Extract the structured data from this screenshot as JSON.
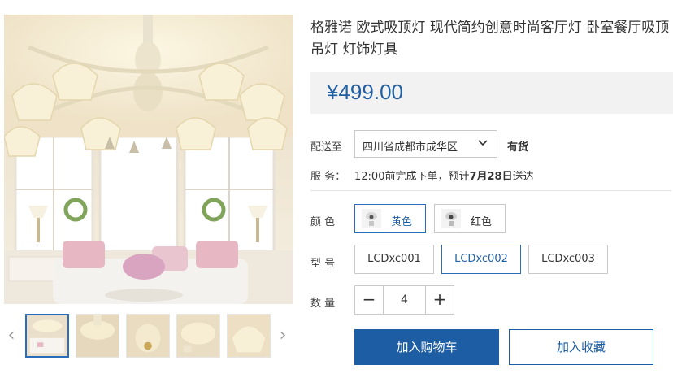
{
  "product": {
    "title": "格雅诺 欧式吸顶灯 现代简约创意时尚客厅灯 卧室餐厅吸顶吊灯 灯饰灯具",
    "price": "¥499.00"
  },
  "gallery": {
    "main_image": "chandelier-living-room-photo",
    "prev_icon": "chevron-left-icon",
    "next_icon": "chevron-right-icon",
    "thumbnails": [
      {
        "image": "chandelier-thumb-1",
        "active": true
      },
      {
        "image": "chandelier-thumb-2",
        "active": false
      },
      {
        "image": "chandelier-thumb-3",
        "active": false
      },
      {
        "image": "chandelier-thumb-4",
        "active": false
      },
      {
        "image": "chandelier-thumb-5",
        "active": false
      }
    ]
  },
  "shipping": {
    "label": "配送至",
    "region": "四川省成都市成华区",
    "stock": "有货"
  },
  "service": {
    "label": "服  务：",
    "text_prefix": "12:00前完成下单，预计",
    "date": "7月28日",
    "text_suffix": "送达"
  },
  "color": {
    "label": "颜  色",
    "options": [
      {
        "label": "黄色",
        "selected": true
      },
      {
        "label": "红色",
        "selected": false
      }
    ]
  },
  "model": {
    "label": "型  号",
    "options": [
      {
        "label": "LCDxc001",
        "selected": false
      },
      {
        "label": "LCDxc002",
        "selected": true
      },
      {
        "label": "LCDxc003",
        "selected": false
      }
    ]
  },
  "quantity": {
    "label": "数  量",
    "value": "4",
    "minus": "−",
    "plus": "+"
  },
  "actions": {
    "add_to_cart": "加入购物车",
    "add_to_favorites": "加入收藏"
  },
  "colors": {
    "accent": "#1c5da3",
    "price": "#1f5fa4",
    "selected_border": "#2a6ebb",
    "price_bg": "#f2f2f2"
  }
}
